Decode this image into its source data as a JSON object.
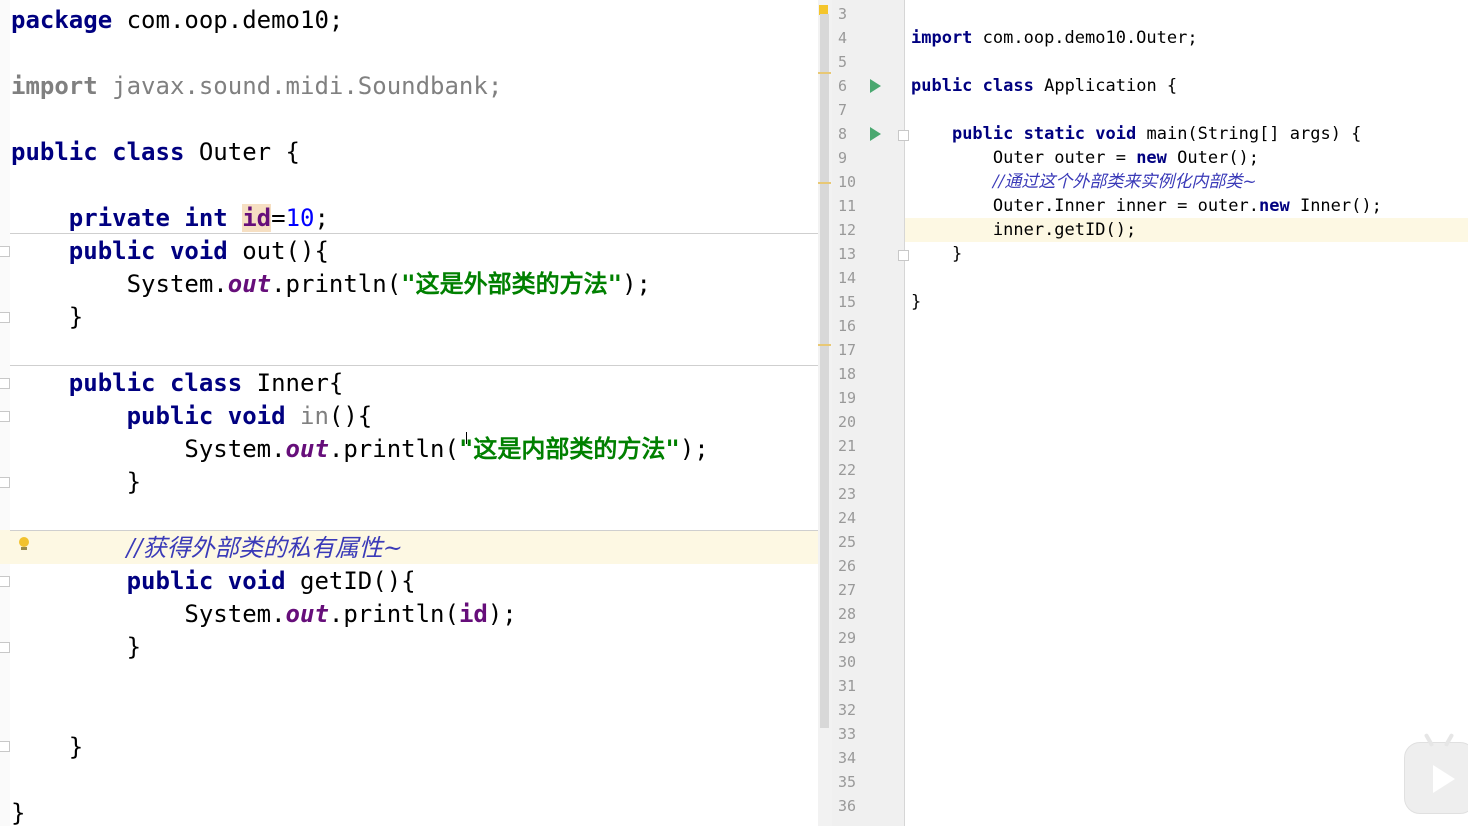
{
  "left_editor": {
    "line_package_kw": "package",
    "line_package_rest": " com.oop.demo10;",
    "line_import_kw": "import",
    "line_import_rest": " javax.sound.midi.Soundbank;",
    "class_public": "public",
    "class_class": "class",
    "class_name": " Outer {",
    "field_private": "private",
    "field_int": "int",
    "field_id": "id",
    "field_eq": "=",
    "field_value": "10",
    "field_end": ";",
    "out_public": "public",
    "out_void": "void",
    "out_sig": " out(){",
    "out_sys": "System.",
    "out_out": "out",
    "out_println": ".println(",
    "out_string": "\"这是外部类的方法\"",
    "out_end": ");",
    "brace_close": "}",
    "inner_public": "public",
    "inner_class": "class",
    "inner_name": " Inner{",
    "in_public": "public",
    "in_void": "void",
    "in_name": "in",
    "in_paren": "(){",
    "in_sys": "System.",
    "in_out": "out",
    "in_println": ".println(",
    "in_string": "\"这是内部类的方法\"",
    "in_end": ");",
    "comment": "//获得外部类的私有属性~",
    "getid_public": "public",
    "getid_void": "void",
    "getid_sig": " getID(){",
    "getid_sys": "System.",
    "getid_out": "out",
    "getid_println": ".println(",
    "getid_arg": "id",
    "getid_end": ");"
  },
  "right_editor": {
    "line_numbers": [
      "3",
      "4",
      "5",
      "6",
      "7",
      "8",
      "9",
      "10",
      "11",
      "12",
      "13",
      "14",
      "15",
      "16",
      "17",
      "18",
      "19",
      "20",
      "21",
      "22",
      "23",
      "24",
      "25",
      "26",
      "27",
      "28",
      "29",
      "30",
      "31",
      "32",
      "33",
      "34",
      "35",
      "36"
    ],
    "l4_kw": "import",
    "l4_rest": " com.oop.demo10.Outer;",
    "l6_public": "public",
    "l6_class": "class",
    "l6_rest": " Application {",
    "l8_public": "public",
    "l8_static": "static",
    "l8_void": "void",
    "l8_rest": " main(String[] args) {",
    "l9_a": "Outer outer = ",
    "l9_new": "new",
    "l9_b": " Outer();",
    "l10_comment": "//通过这个外部类来实例化内部类~",
    "l11_a": "Outer.Inner inner = outer.",
    "l11_new": "new",
    "l11_b": " Inner();",
    "l12": "inner.getID();",
    "l13": "}",
    "l15": "}"
  }
}
